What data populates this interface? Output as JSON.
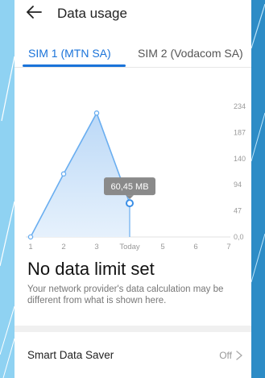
{
  "header": {
    "title": "Data usage",
    "back_icon": "back-arrow-icon"
  },
  "tabs": [
    {
      "label": "SIM 1 (MTN SA)",
      "active": true
    },
    {
      "label": "SIM 2 (Vodacom SA)",
      "active": false
    }
  ],
  "chart_data": {
    "type": "area",
    "x_labels": [
      "1",
      "2",
      "3",
      "Today",
      "5",
      "6",
      "7"
    ],
    "y_ticks": [
      "0,0",
      "47",
      "94",
      "140",
      "187",
      "234"
    ],
    "ylim": [
      0,
      234
    ],
    "points": [
      {
        "x": 1,
        "y": 0
      },
      {
        "x": 2,
        "y": 113
      },
      {
        "x": 3,
        "y": 222
      },
      {
        "x": 4,
        "y": 60.45
      }
    ],
    "tooltip": "60,45 MB",
    "colors": {
      "line": "#6aaef0",
      "fill_top": "#bcd9f7",
      "fill_bottom": "#e6f1fc",
      "tooltip": "#8a8a8a",
      "highlight": "#3a8ee6"
    }
  },
  "limit": {
    "title": "No data limit set",
    "description": "Your network provider's data calculation may be different from what is shown here."
  },
  "smart_saver": {
    "label": "Smart Data Saver",
    "value": "Off"
  },
  "colors": {
    "accent": "#1a73d9",
    "background": "#0e3f5a"
  }
}
